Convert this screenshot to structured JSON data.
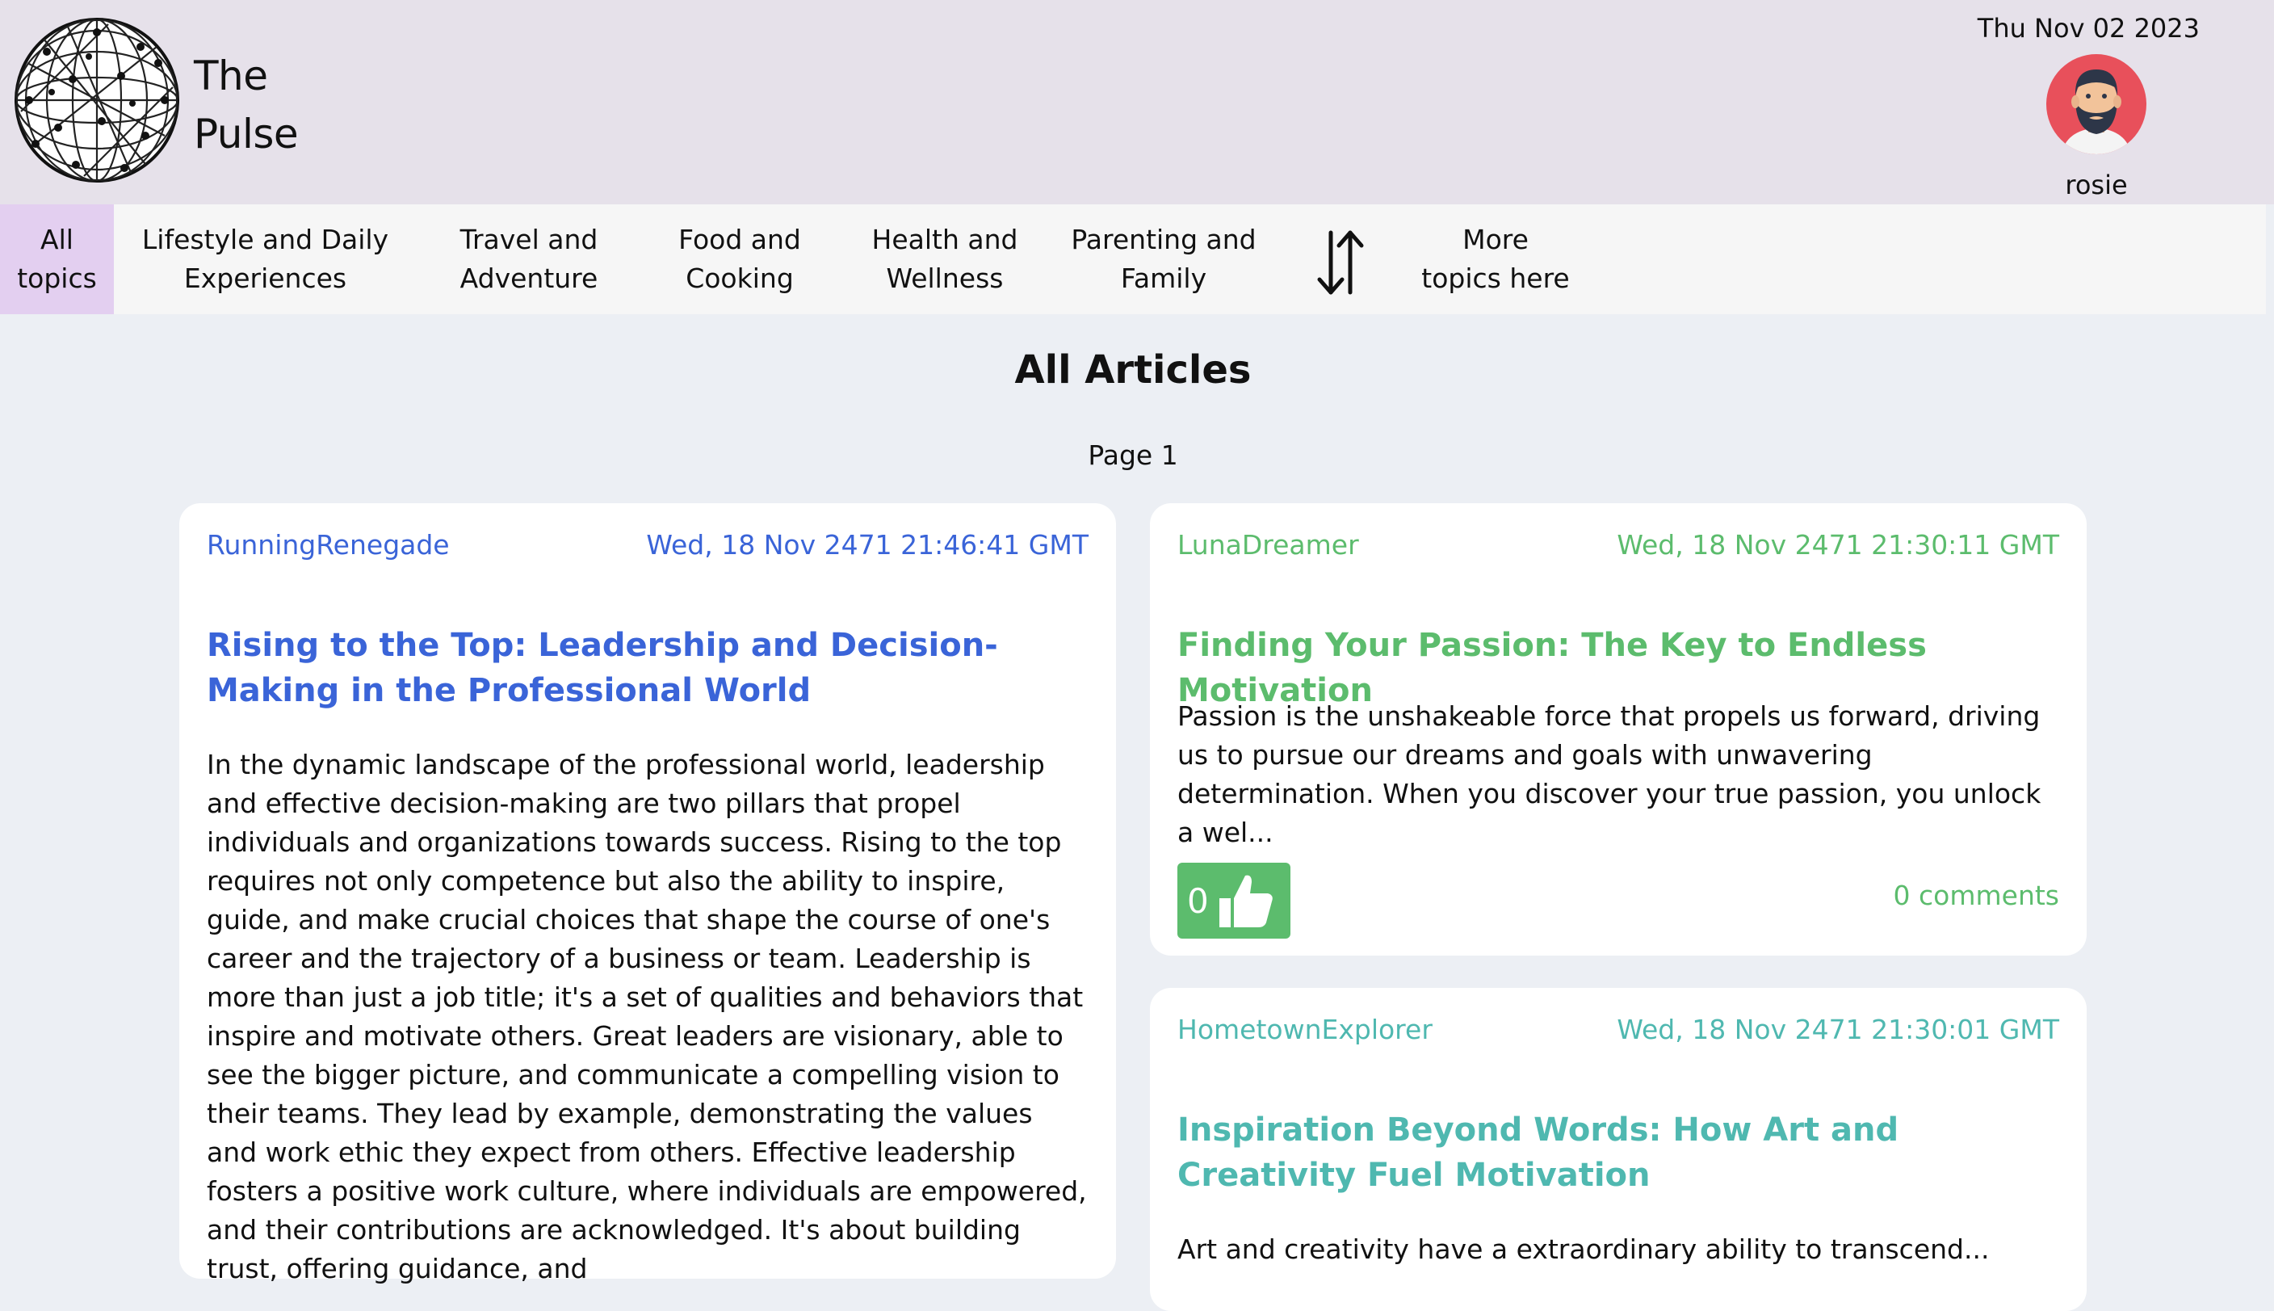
{
  "header": {
    "brand": "The\nPulse",
    "date": "Thu Nov 02 2023",
    "username": "rosie"
  },
  "icons": {
    "logo": "globe-network-icon",
    "avatar": "bearded-man-avatar",
    "sort": "sort-arrows-icon",
    "like": "thumbs-up-icon"
  },
  "nav": {
    "items": [
      {
        "label": "All\ntopics"
      },
      {
        "label": "Lifestyle and Daily\nExperiences"
      },
      {
        "label": "Travel and\nAdventure"
      },
      {
        "label": "Food and\nCooking"
      },
      {
        "label": "Health and\nWellness"
      },
      {
        "label": "Parenting and\nFamily"
      },
      {
        "label": "More\ntopics here"
      }
    ]
  },
  "main": {
    "title": "All Articles",
    "page": "Page 1"
  },
  "articles": [
    {
      "author": "RunningRenegade",
      "timestamp": "Wed, 18 Nov 2471 21:46:41 GMT",
      "title": "Rising to the Top: Leadership and Decision-Making in the Professional World",
      "body": "In the dynamic landscape of the professional world, leadership and effective decision-making are two pillars that propel individuals and organizations towards success. Rising to the top requires not only competence but also the ability to inspire, guide, and make crucial choices that shape the course of one's career and the trajectory of a business or team. Leadership is more than just a job title; it's a set of qualities and behaviors that inspire and motivate others. Great leaders are visionary, able to see the bigger picture, and communicate a compelling vision to their teams. They lead by example, demonstrating the values and work ethic they expect from others. Effective leadership fosters a positive work culture, where individuals are empowered, and their contributions are acknowledged. It's about building trust, offering guidance, and",
      "color": "#3a64d8"
    },
    {
      "author": "LunaDreamer",
      "timestamp": "Wed, 18 Nov 2471 21:30:11 GMT",
      "title": "Finding Your Passion: The Key to Endless Motivation",
      "body": "Passion is the unshakeable force that propels us forward, driving us to pursue our dreams and goals with unwavering determination. When you discover your true passion, you unlock a wel...",
      "likes": "0",
      "comments": "0 comments",
      "color": "#5cbc6d"
    },
    {
      "author": "HometownExplorer",
      "timestamp": "Wed, 18 Nov 2471 21:30:01 GMT",
      "title": "Inspiration Beyond Words: How Art and Creativity Fuel Motivation",
      "body": "Art and creativity have a extraordinary ability to transcend...",
      "color": "#4fb8b0"
    }
  ]
}
